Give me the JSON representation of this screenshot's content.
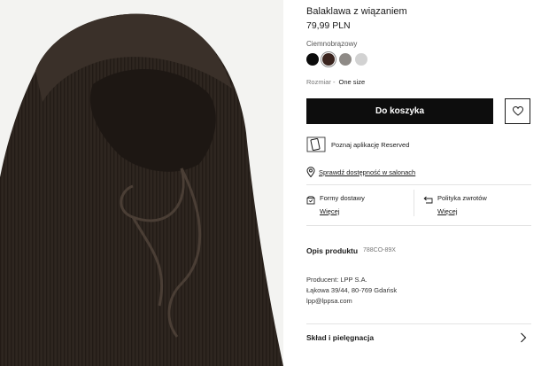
{
  "product": {
    "name": "Balaklawa z wiązaniem",
    "price": "79,99 PLN",
    "color_label": "Ciemnobrązowy",
    "image_icon": "balaclava-photo"
  },
  "colors": [
    {
      "name": "black",
      "hex": "#0b0b0b",
      "selected": false
    },
    {
      "name": "dark-brown",
      "hex": "#3a241e",
      "selected": true
    },
    {
      "name": "grey",
      "hex": "#8e8a86",
      "selected": false
    },
    {
      "name": "light-grey",
      "hex": "#d2d2d2",
      "selected": false
    }
  ],
  "size": {
    "label": "Rozmiar -",
    "value": "One size"
  },
  "actions": {
    "add_to_cart": "Do koszyka",
    "favorite_icon": "heart-icon"
  },
  "app": {
    "text": "Poznaj aplikację Reserved",
    "icon": "phone-icon"
  },
  "store": {
    "text": "Sprawdź dostępność w salonach",
    "icon": "location-pin-icon"
  },
  "delivery": {
    "title": "Formy dostawy",
    "link": "Więcej",
    "icon": "box-icon"
  },
  "returns": {
    "title": "Polityka zwrotów",
    "link": "Więcej",
    "icon": "return-arrow-icon"
  },
  "description": {
    "title": "Opis produktu",
    "code": "788CO-89X",
    "producer_lines": [
      "Producent: LPP S.A.",
      "Łąkowa 39/44, 80-769 Gdańsk",
      "lpp@lppsa.com"
    ]
  },
  "care": {
    "title": "Skład i pielęgnacja",
    "icon": "chevron-right-icon"
  },
  "theme": {
    "accent": "#0d0d0d",
    "product_color": "#2e2620"
  }
}
